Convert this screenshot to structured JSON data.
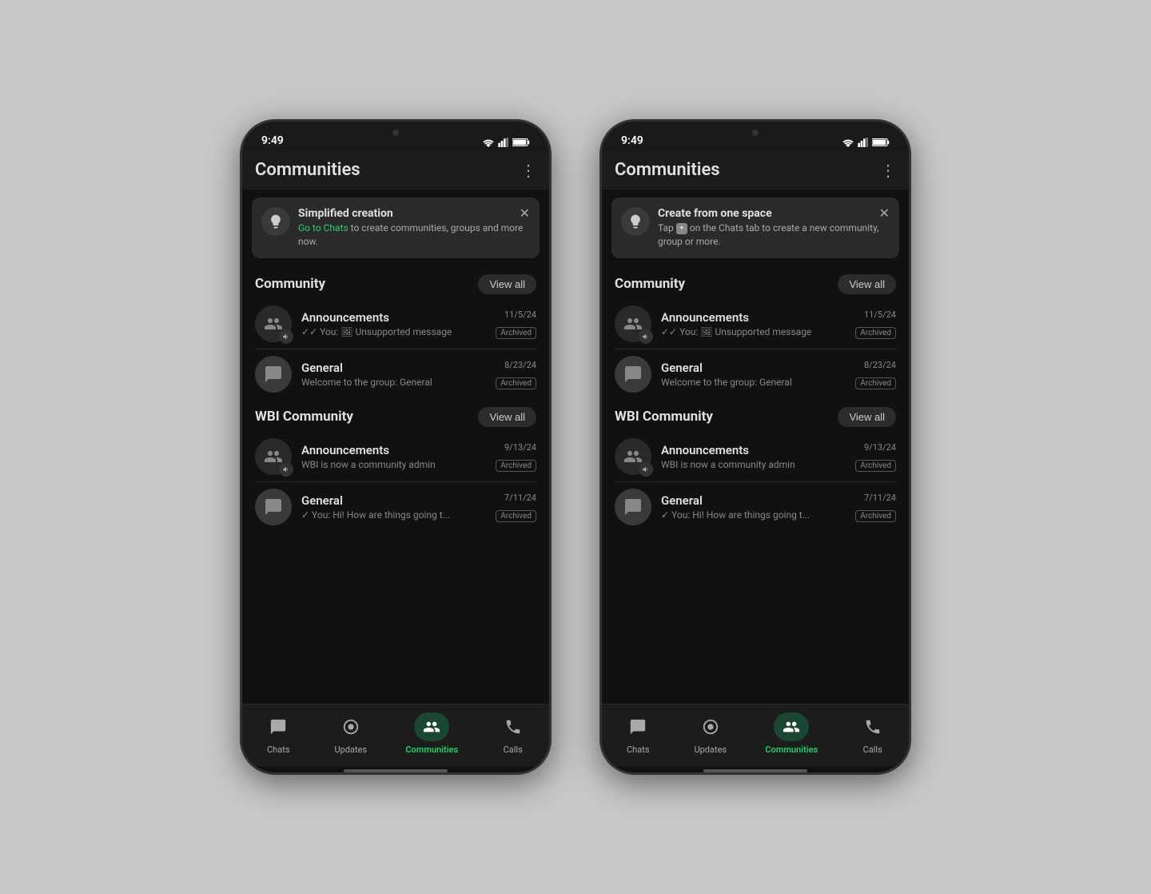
{
  "phones": [
    {
      "id": "phone-left",
      "time": "9:49",
      "header_title": "Communities",
      "banner": {
        "title": "Simplified creation",
        "body_prefix": "",
        "link_text": "Go to Chats",
        "body_suffix": " to create communities, groups and more now."
      },
      "communities": [
        {
          "name": "Community",
          "view_all": "View all",
          "chats": [
            {
              "name": "Announcements",
              "time": "11/5/24",
              "preview": "✓✓ You: 🖼 Unsupported message",
              "archived": "Archived",
              "type": "community"
            },
            {
              "name": "General",
              "time": "8/23/24",
              "preview": "Welcome to the group: General",
              "archived": "Archived",
              "type": "group"
            }
          ]
        },
        {
          "name": "WBI Community",
          "view_all": "View all",
          "chats": [
            {
              "name": "Announcements",
              "time": "9/13/24",
              "preview": "WBI is now a community admin",
              "archived": "Archived",
              "type": "community"
            },
            {
              "name": "General",
              "time": "7/11/24",
              "preview": "✓ You: Hi! How are things going t...",
              "archived": "Archived",
              "type": "group"
            }
          ]
        }
      ],
      "nav": {
        "items": [
          {
            "label": "Chats",
            "icon": "chats-icon",
            "active": false
          },
          {
            "label": "Updates",
            "icon": "updates-icon",
            "active": false
          },
          {
            "label": "Communities",
            "icon": "communities-icon",
            "active": true
          },
          {
            "label": "Calls",
            "icon": "calls-icon",
            "active": false
          }
        ]
      }
    },
    {
      "id": "phone-right",
      "time": "9:49",
      "header_title": "Communities",
      "banner": {
        "title": "Create from one space",
        "body_prefix": "Tap ",
        "link_text": "",
        "body_suffix": " on the Chats tab to create a new community, group or more."
      },
      "communities": [
        {
          "name": "Community",
          "view_all": "View all",
          "chats": [
            {
              "name": "Announcements",
              "time": "11/5/24",
              "preview": "✓✓ You: 🖼 Unsupported message",
              "archived": "Archived",
              "type": "community"
            },
            {
              "name": "General",
              "time": "8/23/24",
              "preview": "Welcome to the group: General",
              "archived": "Archived",
              "type": "group"
            }
          ]
        },
        {
          "name": "WBI Community",
          "view_all": "View all",
          "chats": [
            {
              "name": "Announcements",
              "time": "9/13/24",
              "preview": "WBI is now a community admin",
              "archived": "Archived",
              "type": "community"
            },
            {
              "name": "General",
              "time": "7/11/24",
              "preview": "✓ You: Hi! How are things going t...",
              "archived": "Archived",
              "type": "group"
            }
          ]
        }
      ],
      "nav": {
        "items": [
          {
            "label": "Chats",
            "icon": "chats-icon",
            "active": false
          },
          {
            "label": "Updates",
            "icon": "updates-icon",
            "active": false
          },
          {
            "label": "Communities",
            "icon": "communities-icon",
            "active": true
          },
          {
            "label": "Calls",
            "icon": "calls-icon",
            "active": false
          }
        ]
      }
    }
  ]
}
